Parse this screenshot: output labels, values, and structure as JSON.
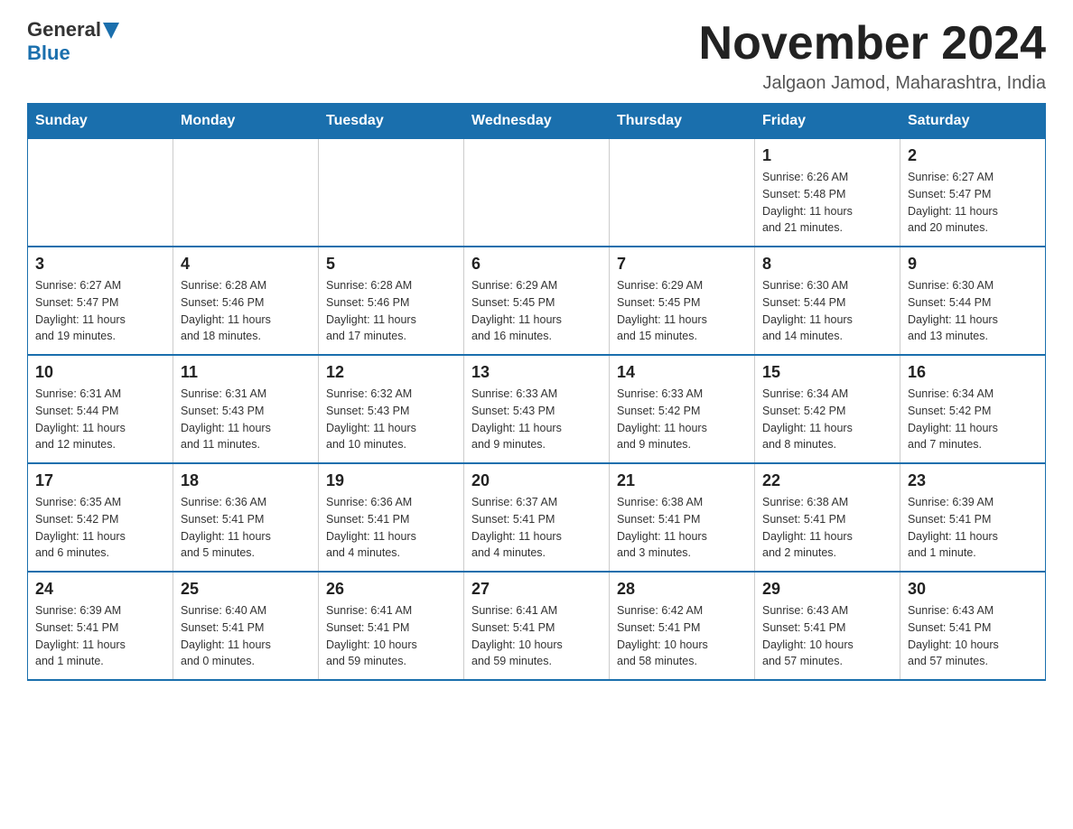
{
  "header": {
    "logo": {
      "general": "General",
      "blue": "Blue"
    },
    "title": "November 2024",
    "subtitle": "Jalgaon Jamod, Maharashtra, India"
  },
  "calendar": {
    "days_of_week": [
      "Sunday",
      "Monday",
      "Tuesday",
      "Wednesday",
      "Thursday",
      "Friday",
      "Saturday"
    ],
    "weeks": [
      [
        {
          "day": "",
          "info": ""
        },
        {
          "day": "",
          "info": ""
        },
        {
          "day": "",
          "info": ""
        },
        {
          "day": "",
          "info": ""
        },
        {
          "day": "",
          "info": ""
        },
        {
          "day": "1",
          "info": "Sunrise: 6:26 AM\nSunset: 5:48 PM\nDaylight: 11 hours\nand 21 minutes."
        },
        {
          "day": "2",
          "info": "Sunrise: 6:27 AM\nSunset: 5:47 PM\nDaylight: 11 hours\nand 20 minutes."
        }
      ],
      [
        {
          "day": "3",
          "info": "Sunrise: 6:27 AM\nSunset: 5:47 PM\nDaylight: 11 hours\nand 19 minutes."
        },
        {
          "day": "4",
          "info": "Sunrise: 6:28 AM\nSunset: 5:46 PM\nDaylight: 11 hours\nand 18 minutes."
        },
        {
          "day": "5",
          "info": "Sunrise: 6:28 AM\nSunset: 5:46 PM\nDaylight: 11 hours\nand 17 minutes."
        },
        {
          "day": "6",
          "info": "Sunrise: 6:29 AM\nSunset: 5:45 PM\nDaylight: 11 hours\nand 16 minutes."
        },
        {
          "day": "7",
          "info": "Sunrise: 6:29 AM\nSunset: 5:45 PM\nDaylight: 11 hours\nand 15 minutes."
        },
        {
          "day": "8",
          "info": "Sunrise: 6:30 AM\nSunset: 5:44 PM\nDaylight: 11 hours\nand 14 minutes."
        },
        {
          "day": "9",
          "info": "Sunrise: 6:30 AM\nSunset: 5:44 PM\nDaylight: 11 hours\nand 13 minutes."
        }
      ],
      [
        {
          "day": "10",
          "info": "Sunrise: 6:31 AM\nSunset: 5:44 PM\nDaylight: 11 hours\nand 12 minutes."
        },
        {
          "day": "11",
          "info": "Sunrise: 6:31 AM\nSunset: 5:43 PM\nDaylight: 11 hours\nand 11 minutes."
        },
        {
          "day": "12",
          "info": "Sunrise: 6:32 AM\nSunset: 5:43 PM\nDaylight: 11 hours\nand 10 minutes."
        },
        {
          "day": "13",
          "info": "Sunrise: 6:33 AM\nSunset: 5:43 PM\nDaylight: 11 hours\nand 9 minutes."
        },
        {
          "day": "14",
          "info": "Sunrise: 6:33 AM\nSunset: 5:42 PM\nDaylight: 11 hours\nand 9 minutes."
        },
        {
          "day": "15",
          "info": "Sunrise: 6:34 AM\nSunset: 5:42 PM\nDaylight: 11 hours\nand 8 minutes."
        },
        {
          "day": "16",
          "info": "Sunrise: 6:34 AM\nSunset: 5:42 PM\nDaylight: 11 hours\nand 7 minutes."
        }
      ],
      [
        {
          "day": "17",
          "info": "Sunrise: 6:35 AM\nSunset: 5:42 PM\nDaylight: 11 hours\nand 6 minutes."
        },
        {
          "day": "18",
          "info": "Sunrise: 6:36 AM\nSunset: 5:41 PM\nDaylight: 11 hours\nand 5 minutes."
        },
        {
          "day": "19",
          "info": "Sunrise: 6:36 AM\nSunset: 5:41 PM\nDaylight: 11 hours\nand 4 minutes."
        },
        {
          "day": "20",
          "info": "Sunrise: 6:37 AM\nSunset: 5:41 PM\nDaylight: 11 hours\nand 4 minutes."
        },
        {
          "day": "21",
          "info": "Sunrise: 6:38 AM\nSunset: 5:41 PM\nDaylight: 11 hours\nand 3 minutes."
        },
        {
          "day": "22",
          "info": "Sunrise: 6:38 AM\nSunset: 5:41 PM\nDaylight: 11 hours\nand 2 minutes."
        },
        {
          "day": "23",
          "info": "Sunrise: 6:39 AM\nSunset: 5:41 PM\nDaylight: 11 hours\nand 1 minute."
        }
      ],
      [
        {
          "day": "24",
          "info": "Sunrise: 6:39 AM\nSunset: 5:41 PM\nDaylight: 11 hours\nand 1 minute."
        },
        {
          "day": "25",
          "info": "Sunrise: 6:40 AM\nSunset: 5:41 PM\nDaylight: 11 hours\nand 0 minutes."
        },
        {
          "day": "26",
          "info": "Sunrise: 6:41 AM\nSunset: 5:41 PM\nDaylight: 10 hours\nand 59 minutes."
        },
        {
          "day": "27",
          "info": "Sunrise: 6:41 AM\nSunset: 5:41 PM\nDaylight: 10 hours\nand 59 minutes."
        },
        {
          "day": "28",
          "info": "Sunrise: 6:42 AM\nSunset: 5:41 PM\nDaylight: 10 hours\nand 58 minutes."
        },
        {
          "day": "29",
          "info": "Sunrise: 6:43 AM\nSunset: 5:41 PM\nDaylight: 10 hours\nand 57 minutes."
        },
        {
          "day": "30",
          "info": "Sunrise: 6:43 AM\nSunset: 5:41 PM\nDaylight: 10 hours\nand 57 minutes."
        }
      ]
    ]
  }
}
